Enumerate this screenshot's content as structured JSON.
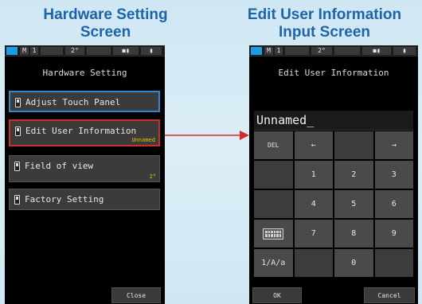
{
  "captions": {
    "left_line1": "Hardware Setting",
    "left_line2": "Screen",
    "right_line1": "Edit User Information",
    "right_line2": "Input Screen"
  },
  "status_bar": {
    "mode": "M",
    "memory": "1",
    "angle": "2°",
    "mode_icon": "record-icon",
    "battery": "battery-icon"
  },
  "hardware_screen": {
    "title": "Hardware Setting",
    "items": [
      {
        "label": "Adjust Touch Panel",
        "value": ""
      },
      {
        "label": "Edit User Information",
        "value": "Unnamed"
      },
      {
        "label": "Field of view",
        "value": "2°"
      },
      {
        "label": "Factory Setting",
        "value": ""
      }
    ],
    "close_label": "Close"
  },
  "edit_screen": {
    "title": "Edit User Information",
    "input_value": "Unnamed_",
    "keys": {
      "del": "DEL",
      "left": "←",
      "right": "→",
      "k1": "1",
      "k2": "2",
      "k3": "3",
      "k4": "4",
      "k5": "5",
      "k6": "6",
      "k7": "7",
      "k8": "8",
      "k9": "9",
      "k0": "0",
      "mode": "1/A/a"
    },
    "ok_label": "OK",
    "cancel_label": "Cancel"
  },
  "colors": {
    "caption": "#1e64a8",
    "selection_blue": "#2a8bd2",
    "highlight_red": "#d72b2b",
    "value_yellow": "#e8c400"
  }
}
